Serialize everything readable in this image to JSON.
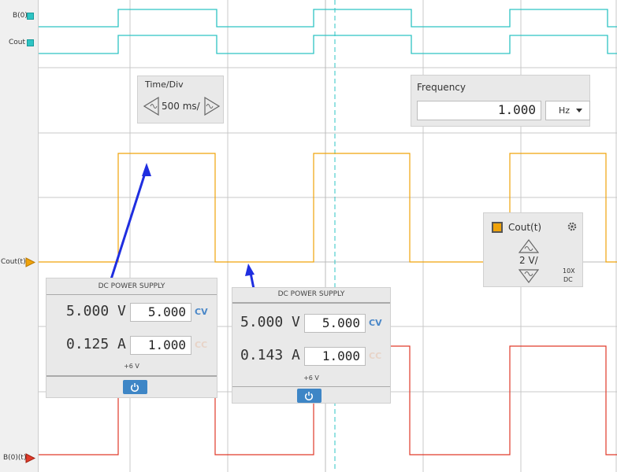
{
  "channels": {
    "b0": {
      "label": "B(0)",
      "color": "#2ec4c4"
    },
    "cout": {
      "label": "Cout",
      "color": "#2ec4c4"
    },
    "cout_t": {
      "label": "Cout(t)",
      "color": "#f0a30a"
    },
    "b0_t": {
      "label": "B(0)(t)",
      "color": "#e03a2a"
    }
  },
  "timebase": {
    "title": "Time/Div",
    "value": "500 ms/"
  },
  "frequency": {
    "title": "Frequency",
    "value": "1.000",
    "unit": "Hz"
  },
  "cout_panel": {
    "title": "Cout(t)",
    "volts_div": "2 V/",
    "probe": "10X",
    "coupling": "DC"
  },
  "power_supplies": [
    {
      "title": "DC POWER SUPPLY",
      "voltage_reading": "5.000 V",
      "voltage_set": "5.000",
      "cv_label": "CV",
      "current_reading": "0.125 A",
      "current_set": "1.000",
      "cc_label": "CC",
      "rail": "+6 V"
    },
    {
      "title": "DC POWER SUPPLY",
      "voltage_reading": "5.000 V",
      "voltage_set": "5.000",
      "cv_label": "CV",
      "current_reading": "0.143 A",
      "current_set": "1.000",
      "cc_label": "CC",
      "rail": "+6 V"
    }
  ],
  "colors": {
    "grid": "#c8c8c8",
    "cursor": "#2ec4c4",
    "annotation_arrow": "#1f2ee0",
    "accent": "#3e86c6"
  }
}
